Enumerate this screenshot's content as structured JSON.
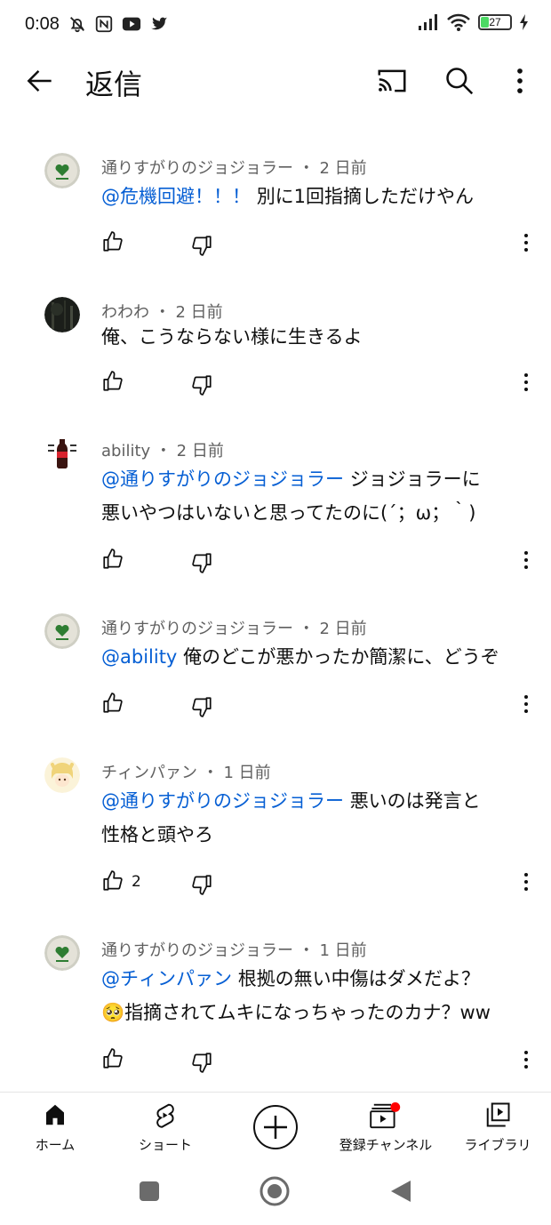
{
  "status": {
    "time": "0:08",
    "battery": "27",
    "left_icons": [
      "bell-off-icon",
      "nfc-icon",
      "youtube-icon",
      "twitter-icon"
    ],
    "right_icons": [
      "signal-icon",
      "wifi-icon",
      "battery-icon",
      "charging-icon"
    ]
  },
  "app_bar": {
    "title": "返信",
    "back_icon": "arrow-left-icon",
    "actions": [
      "cast-icon",
      "search-icon",
      "more-vert-icon"
    ]
  },
  "comments": [
    {
      "author": "通りすがりのジョジョラー",
      "time": "2 日前",
      "mention": "@危機回避！！！",
      "lines": [
        "別に1回指摘しただけやん"
      ],
      "likes": "",
      "avatar": "green-heart-avatar"
    },
    {
      "author": "わわわ",
      "time": "2 日前",
      "mention": "",
      "lines": [
        "俺、こうならない様に生きるよ"
      ],
      "likes": "",
      "avatar": "dark-forest-avatar"
    },
    {
      "author": "ability",
      "time": "2 日前",
      "mention": "@通りすがりのジョジョラー",
      "lines": [
        "ジョジョラーに",
        "悪いやつはいないと思ってたのに(´；ω；｀)"
      ],
      "likes": "",
      "avatar": "cola-avatar"
    },
    {
      "author": "通りすがりのジョジョラー",
      "time": "2 日前",
      "mention": "@ability",
      "lines": [
        "俺のどこが悪かったか簡潔に、どうぞ"
      ],
      "likes": "",
      "avatar": "green-heart-avatar"
    },
    {
      "author": "チィンパァン",
      "time": "1 日前",
      "mention": "@通りすがりのジョジョラー",
      "lines": [
        "悪いのは発言と",
        "性格と頭やろ"
      ],
      "likes": "2",
      "avatar": "anime-girl-avatar"
    },
    {
      "author": "通りすがりのジョジョラー",
      "time": "1 日前",
      "mention": "@チィンパァン",
      "lines": [
        "根拠の無い中傷はダメだよ？",
        "🥺指摘されてムキになっちゃったのカナ？ww"
      ],
      "likes": "",
      "avatar": "green-heart-avatar"
    }
  ],
  "meta_separator": "・",
  "bottom_nav": [
    {
      "label": "ホーム",
      "icon": "home-icon"
    },
    {
      "label": "ショート",
      "icon": "shorts-icon"
    },
    {
      "label": "",
      "icon": "create-plus-icon"
    },
    {
      "label": "登録チャンネル",
      "icon": "subscriptions-icon"
    },
    {
      "label": "ライブラリ",
      "icon": "library-icon"
    }
  ],
  "colors": {
    "mention": "#065fd4",
    "meta": "#606060",
    "text": "#0f0f0f",
    "notification_dot": "#ff0000",
    "avatar_heart": "#2e7d32"
  }
}
